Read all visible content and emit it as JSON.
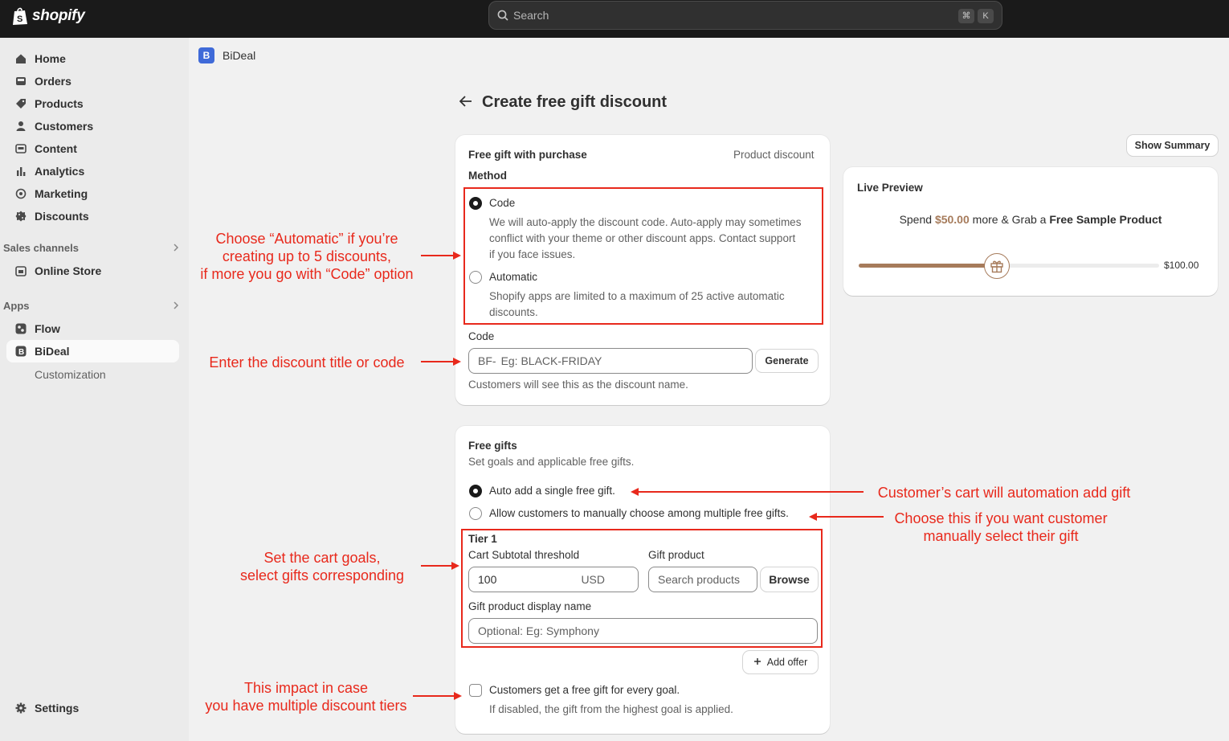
{
  "topbar": {
    "brand": "shopify",
    "search_placeholder": "Search",
    "shortcut_keys": [
      "⌘",
      "K"
    ]
  },
  "sidebar": {
    "main_items": [
      {
        "label": "Home",
        "icon": "home-icon"
      },
      {
        "label": "Orders",
        "icon": "inbox-icon"
      },
      {
        "label": "Products",
        "icon": "tag-icon"
      },
      {
        "label": "Customers",
        "icon": "person-icon"
      },
      {
        "label": "Content",
        "icon": "content-icon"
      },
      {
        "label": "Analytics",
        "icon": "bar-chart-icon"
      },
      {
        "label": "Marketing",
        "icon": "target-icon"
      },
      {
        "label": "Discounts",
        "icon": "discount-icon"
      }
    ],
    "sales_channels_label": "Sales channels",
    "online_store_label": "Online Store",
    "apps_label": "Apps",
    "flow_label": "Flow",
    "bideal_label": "BiDeal",
    "customization_label": "Customization",
    "settings_label": "Settings"
  },
  "app_header": {
    "badge": "B",
    "name": "BiDeal"
  },
  "page": {
    "title": "Create free gift discount"
  },
  "method_card": {
    "title": "Free gift with purchase",
    "type": "Product discount",
    "method_label": "Method",
    "code_option": "Code",
    "code_desc_1": "We will auto-apply the discount code. Auto-apply may sometimes",
    "code_desc_2": "conflict with your theme or other discount apps. Contact support",
    "code_desc_3": "if you face issues.",
    "auto_option": "Automatic",
    "auto_desc_1": "Shopify apps are limited to a maximum of 25 active automatic",
    "auto_desc_2": "discounts.",
    "code_label": "Code",
    "code_prefix": "BF-",
    "code_placeholder": "Eg: BLACK-FRIDAY",
    "generate_label": "Generate",
    "code_help": "Customers will see this as the discount name."
  },
  "gifts_card": {
    "title": "Free gifts",
    "subtitle": "Set goals and applicable free gifts.",
    "auto_add_option": "Auto add a single free gift.",
    "manual_option": "Allow customers to manually choose among multiple free gifts.",
    "tier_label": "Tier 1",
    "threshold_label": "Cart Subtotal threshold",
    "threshold_value": "100",
    "currency": "USD",
    "gift_product_label": "Gift product",
    "search_placeholder": "Search products",
    "browse_label": "Browse",
    "display_name_label": "Gift product display name",
    "display_name_placeholder": "Optional:  Eg: Symphony",
    "add_offer_label": "Add offer",
    "every_goal_label": "Customers get a free gift for every goal.",
    "every_goal_help": "If disabled, the gift from the highest goal is applied."
  },
  "summary_button": "Show Summary",
  "preview": {
    "title": "Live Preview",
    "text_spend": "Spend",
    "text_amount": "$50.00",
    "text_more": "more & Grab a",
    "text_product": "Free Sample Product",
    "progress_fraction": 0.46,
    "max_label": "$100.00"
  },
  "annotations": {
    "method_1": "Choose “Automatic” if you’re",
    "method_2": "creating up to 5 discounts,",
    "method_3": "if more you go with “Code” option",
    "code": "Enter the discount title or code",
    "auto_gift": "Customer’s cart will automation add gift",
    "manual_1": "Choose this if you want customer",
    "manual_2": "manually select their gift",
    "tier_1": "Set the cart goals,",
    "tier_2": "select gifts corresponding",
    "multi_1": "This impact in case",
    "multi_2": "you have multiple discount tiers"
  },
  "colors": {
    "annotation": "#e8291c",
    "accent_brown": "#a67b5b",
    "topbar": "#1a1a1a"
  }
}
